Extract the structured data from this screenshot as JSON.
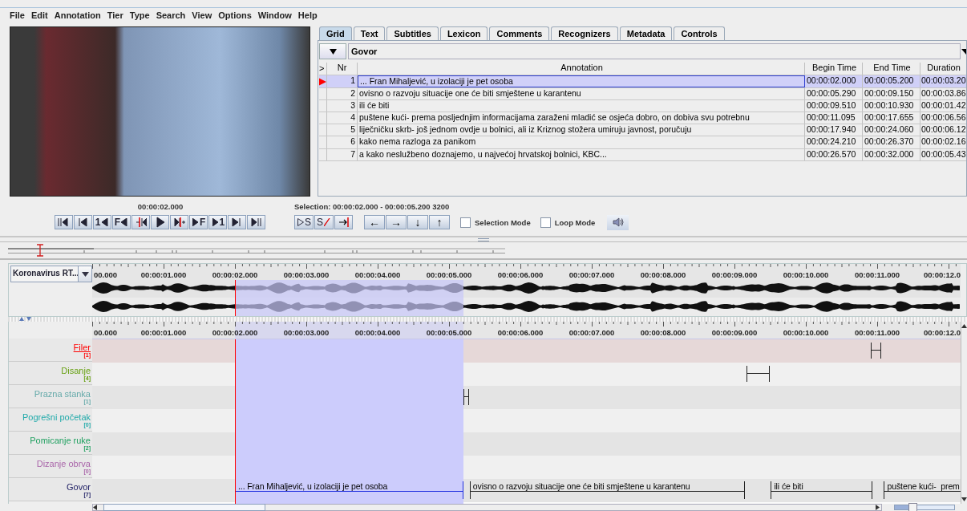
{
  "menu": [
    "File",
    "Edit",
    "Annotation",
    "Tier",
    "Type",
    "Search",
    "View",
    "Options",
    "Window",
    "Help"
  ],
  "tabs": [
    {
      "label": "Grid",
      "selected": true
    },
    {
      "label": "Text",
      "selected": false
    },
    {
      "label": "Subtitles",
      "selected": false
    },
    {
      "label": "Lexicon",
      "selected": false
    },
    {
      "label": "Comments",
      "selected": false
    },
    {
      "label": "Recognizers",
      "selected": false
    },
    {
      "label": "Metadata",
      "selected": false
    },
    {
      "label": "Controls",
      "selected": false
    }
  ],
  "grid": {
    "tier": "Govor",
    "columns": [
      ">",
      "Nr",
      "Annotation",
      "Begin Time",
      "End Time",
      "Duration"
    ],
    "rows": [
      {
        "nr": "1",
        "annotation": "... Fran Mihaljević, u izolaciji je pet osoba",
        "begin": "00:00:02.000",
        "end": "00:00:05.200",
        "duration": "00:00:03.20",
        "selected": true
      },
      {
        "nr": "2",
        "annotation": "ovisno o razvoju situacije one će biti smještene u karantenu",
        "begin": "00:00:05.290",
        "end": "00:00:09.150",
        "duration": "00:00:03.86",
        "selected": false
      },
      {
        "nr": "3",
        "annotation": "ili će biti",
        "begin": "00:00:09.510",
        "end": "00:00:10.930",
        "duration": "00:00:01.42",
        "selected": false
      },
      {
        "nr": "4",
        "annotation": "puštene kući-  prema posljednjim informacijama zaraženi mladić se osjeća dobro, on dobiva svu potrebnu",
        "begin": "00:00:11.095",
        "end": "00:00:17.655",
        "duration": "00:00:06.56",
        "selected": false
      },
      {
        "nr": "5",
        "annotation": "liječničku skrb- još jednom ovdje u bolnici, ali iz Kriznog stožera umiruju javnost, poručuju",
        "begin": "00:00:17.940",
        "end": "00:00:24.060",
        "duration": "00:00:06.12",
        "selected": false
      },
      {
        "nr": "6",
        "annotation": "kako nema razloga za panikom",
        "begin": "00:00:24.210",
        "end": "00:00:26.370",
        "duration": "00:00:02.16",
        "selected": false
      },
      {
        "nr": "7",
        "annotation": "a kako neslužbeno doznajemo, u najvećoj hrvatskoj bolnici, KBC...",
        "begin": "00:00:26.570",
        "end": "00:00:32.000",
        "duration": "00:00:05.43",
        "selected": false
      }
    ]
  },
  "player": {
    "time": "00:00:02.000",
    "buttons": [
      {
        "kind": "begin"
      },
      {
        "kind": "prev-page"
      },
      {
        "kind": "prev-second",
        "label": "1"
      },
      {
        "kind": "prev-frame",
        "label": "F"
      },
      {
        "kind": "prev-pixel"
      },
      {
        "kind": "play"
      },
      {
        "kind": "next-pixel"
      },
      {
        "kind": "next-frame",
        "label": "F"
      },
      {
        "kind": "next-second",
        "label": "1"
      },
      {
        "kind": "next-page"
      },
      {
        "kind": "end"
      }
    ]
  },
  "selection": {
    "text": "Selection: 00:00:02.000 - 00:00:05.200  3200",
    "buttons": [
      {
        "kind": "play-selection",
        "label": "S"
      },
      {
        "kind": "clear-selection",
        "label": "S"
      },
      {
        "kind": "to-selection-end"
      }
    ],
    "nav_buttons": [
      "←",
      "→",
      "↓",
      "↑"
    ],
    "checkboxes": [
      {
        "label": "Selection Mode",
        "checked": false
      },
      {
        "label": "Loop Mode",
        "checked": false
      }
    ]
  },
  "zoom": {
    "level": 0.3
  },
  "waveform": {
    "media": "Koronavirus RT...",
    "ruler": [
      "00.000",
      "00:00:01.000",
      "00:00:02.000",
      "00:00:03.000",
      "00:00:04.000",
      "00:00:05.000",
      "00:00:06.000",
      "00:00:07.000",
      "00:00:08.000",
      "00:00:09.000",
      "00:00:10.000",
      "00:00:11.000",
      "00:00:12.0"
    ]
  },
  "timeline": {
    "ruler": [
      "00.000",
      "00:00:01.000",
      "00:00:02.000",
      "00:00:03.000",
      "00:00:04.000",
      "00:00:05.000",
      "00:00:06.000",
      "00:00:07.000",
      "00:00:08.000",
      "00:00:09.000",
      "00:00:10.000",
      "00:00:11.000",
      "00:00:12.0"
    ],
    "tiers": [
      {
        "name": "Filer",
        "count": "[1]",
        "color": "#ff0000",
        "selected": true
      },
      {
        "name": "Disanje",
        "count": "[4]",
        "color": "#66a010",
        "selected": false
      },
      {
        "name": "Prazna stanka",
        "count": "[1]",
        "color": "#66aaaa",
        "selected": false
      },
      {
        "name": "Pogrešni početak",
        "count": "[0]",
        "color": "#20aaaa",
        "selected": false
      },
      {
        "name": "Pomicanje ruke",
        "count": "[2]",
        "color": "#20a060",
        "selected": false
      },
      {
        "name": "Dizanje obrva",
        "count": "[0]",
        "color": "#aa66aa",
        "selected": false
      },
      {
        "name": "Govor",
        "count": "[7]",
        "color": "#222266",
        "selected": false,
        "annotations": [
          {
            "text": "... Fran Mihaljević, u izolaciji je pet osoba",
            "selected": true
          },
          {
            "text": "ovisno o razvoju situacije one će biti smještene u karantenu",
            "selected": false
          },
          {
            "text": "ili će biti",
            "selected": false
          },
          {
            "text": "puštene kući-  prem",
            "selected": false
          }
        ]
      }
    ]
  }
}
